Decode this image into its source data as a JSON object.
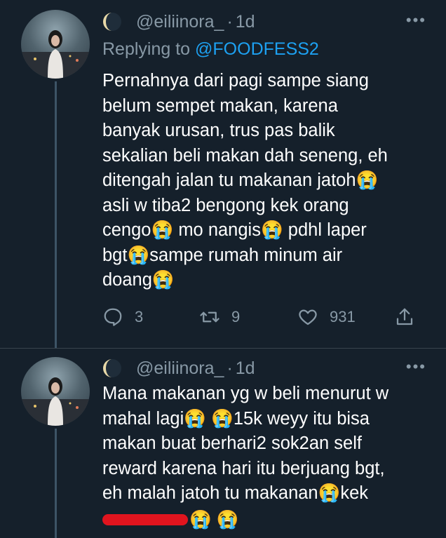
{
  "tweets": [
    {
      "handle": "@eiliinora_",
      "separator": "·",
      "time": "1d",
      "more": "•••",
      "reply_prefix": "Replying to ",
      "reply_mention": "@FOODFESS2",
      "lines": [
        "Pernahnya dari pagi sampe siang",
        "belum sempet makan, karena",
        "banyak urusan, trus pas balik",
        "sekalian beli makan dah seneng, eh",
        "ditengah jalan tu makanan jatoh😭",
        "asli w tiba2 bengong kek orang",
        "cengo😭 mo nangis😭 pdhl laper",
        "bgt😭sampe rumah minum air",
        "doang😭"
      ],
      "actions": {
        "replies": "3",
        "retweets": "9",
        "likes": "931"
      }
    },
    {
      "handle": "@eiliinora_",
      "separator": "·",
      "time": "1d",
      "more": "•••",
      "lines": [
        "Mana makanan yg w beli menurut w",
        "mahal lagi😭 😭15k weyy itu bisa",
        "makan buat berhari2 sok2an self",
        "reward karena hari itu berjuang bgt,",
        "eh malah jatoh tu makanan😭kek"
      ],
      "cutoff_line": "😭 😭"
    }
  ],
  "icons": {
    "moon": "crescent-moon-icon",
    "reply": "reply-icon",
    "retweet": "retweet-icon",
    "like": "heart-icon",
    "share": "share-icon"
  },
  "colors": {
    "background": "#15202b",
    "muted": "#8899a6",
    "link": "#1da1f2",
    "divider": "#38444d",
    "redaction": "#e0141e"
  }
}
